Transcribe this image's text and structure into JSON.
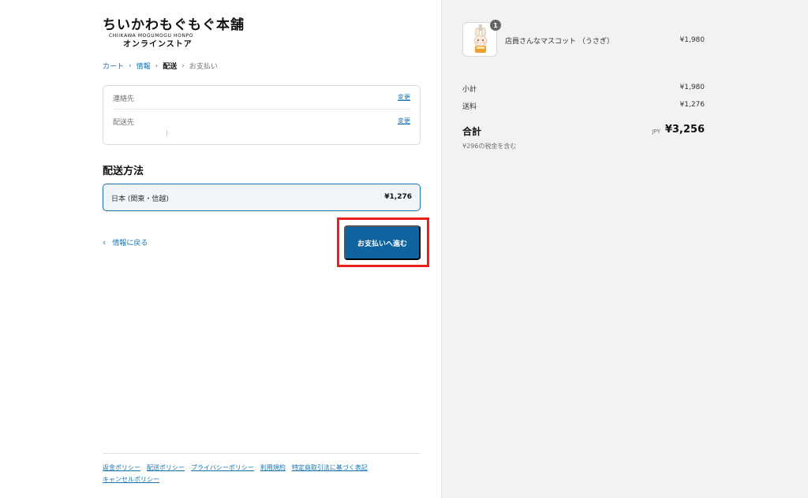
{
  "brand": {
    "logo_line1": "ちいかわもぐもぐ本舗",
    "logo_line2": "CHIIKAWA MOGUMOGU HONPO",
    "logo_line3": "オンラインストア"
  },
  "breadcrumb": {
    "items": [
      "カート",
      "情報",
      "配送",
      "お支払い"
    ],
    "separator": "›"
  },
  "review": {
    "contact_label": "連絡先",
    "contact_change": "変更",
    "shipto_label": "配送先",
    "shipto_change": "変更"
  },
  "shipping": {
    "title": "配送方法",
    "option_name": "日本 (関東・信越)",
    "option_price": "¥1,276"
  },
  "actions": {
    "back_chevron": "‹",
    "back_label": "情報に戻る",
    "continue_label": "お支払いへ進む",
    "highlight_color": "#e8221b",
    "button_color": "#0f64a0"
  },
  "footer": {
    "links": [
      "返金ポリシー",
      "配送ポリシー",
      "プライバシーポリシー",
      "利用規約",
      "特定商取引法に基づく表記",
      "キャンセルポリシー"
    ]
  },
  "summary": {
    "product": {
      "name": "店員さんなマスコット （うさぎ）",
      "price": "¥1,980",
      "quantity": "1",
      "thumbnail_icon": "rabbit-mascot-icon"
    },
    "subtotal_label": "小計",
    "subtotal_value": "¥1,980",
    "shipping_label": "送料",
    "shipping_value": "¥1,276",
    "total_label": "合計",
    "total_currency": "JPY",
    "total_value": "¥3,256",
    "tax_note": "¥296の税金を含む"
  }
}
